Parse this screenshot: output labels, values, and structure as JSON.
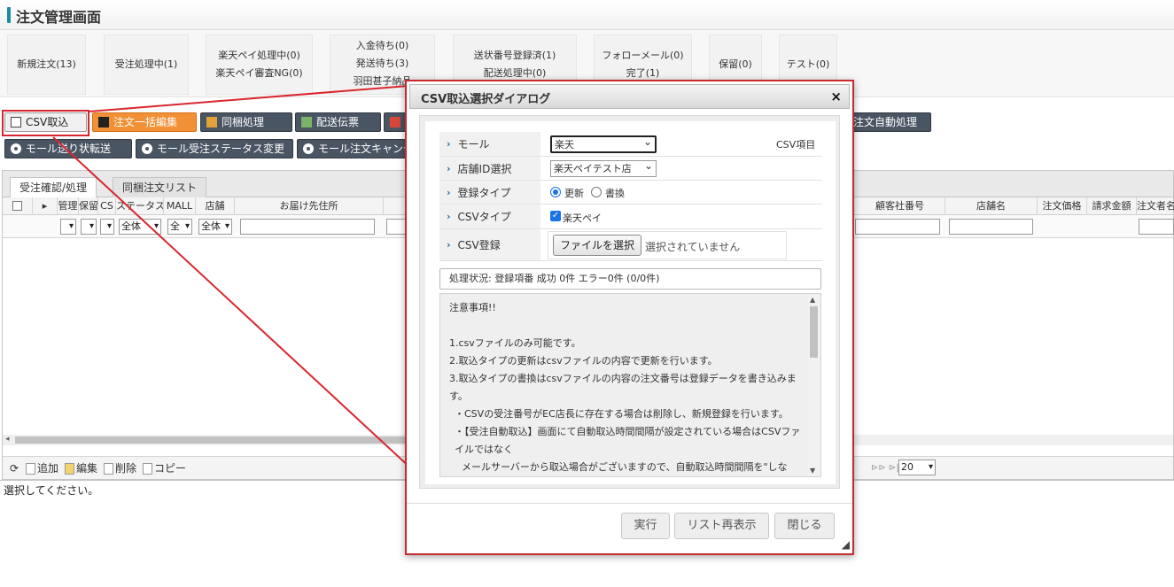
{
  "page": {
    "title": "注文管理画面"
  },
  "status_boxes": [
    {
      "lines": [
        "新規注文(13)"
      ]
    },
    {
      "lines": [
        "受注処理中(1)"
      ]
    },
    {
      "lines": [
        "楽天ペイ処理中(0)",
        "楽天ペイ審査NG(0)"
      ]
    },
    {
      "lines": [
        "入金待ち(0)",
        "発送待ち(3)",
        "羽田甚子納品"
      ]
    },
    {
      "lines": [
        "送状番号登録済(1)",
        "配送処理中(0)"
      ]
    },
    {
      "lines": [
        "フォローメール(0)",
        "完了(1)"
      ]
    },
    {
      "lines": [
        "保留(0)"
      ]
    },
    {
      "lines": [
        "テスト(0)"
      ]
    }
  ],
  "toolbar1": {
    "csv_import": "CSV取込",
    "bulk_edit": "注文一括編集",
    "bundle": "同梱処理",
    "shipping_slip": "配送伝票",
    "auto_process": "注文自動処理"
  },
  "toolbar2": {
    "mall_shipping": "モール送り状転送",
    "mall_status": "モール受注ステータス変更",
    "mall_cancel": "モール注文キャンセル"
  },
  "tabs": [
    "受注確認/処理",
    "同梱注文リスト"
  ],
  "grid": {
    "columns": [
      "管理",
      "保留",
      "CS",
      "ステータス",
      "MALL",
      "店舗",
      "お届け先住所",
      "顧客社番号",
      "店舗名",
      "注文価格",
      "請求金額",
      "注文者名"
    ],
    "filters": {
      "status": "全体",
      "mall": "全",
      "store": "全体"
    }
  },
  "footer": {
    "add": "追加",
    "edit": "編集",
    "delete": "削除",
    "copy": "コピー",
    "page_size": "20",
    "nav": "⊳⊳ ⊳|"
  },
  "select_message": "選択してください。",
  "dialog": {
    "title": "CSV取込選択ダイアログ",
    "close": "×",
    "fields": {
      "mall_label": "モール",
      "mall_value": "楽天",
      "csv_item_label": "CSV項目",
      "store_label": "店舗ID選択",
      "store_value": "楽天ペイテスト店",
      "register_type_label": "登録タイプ",
      "register_update": "更新",
      "register_overwrite": "書換",
      "csv_type_label": "CSVタイプ",
      "csv_type_value": "楽天ペイ",
      "csv_register_label": "CSV登録",
      "file_button": "ファイルを選択",
      "file_status": "選択されていません"
    },
    "status_line": "処理状況: 登録項番 成功 0件 エラー0件 (0/0件)",
    "notes": [
      "注意事項!!",
      "",
      "1.csvファイルのみ可能です。",
      "2.取込タイプの更新はcsvファイルの内容で更新を行います。",
      "3.取込タイプの書換はcsvファイルの内容の注文番号は登録データを書き込みます。",
      "・CSVの受注番号がEC店長に存在する場合は削除し、新規登録を行います。",
      "・【受注自動取込】画面にて自動取込時間間隔が設定されている場合はCSVファイルではなく",
      "メールサーバーから取込場合がございますので、自動取込時間間隔を\"しな"
    ],
    "buttons": {
      "run": "実行",
      "refresh": "リスト再表示",
      "close": "閉じる"
    }
  },
  "colors": {
    "accent": "#1e8aa3",
    "dark_button": "#4a5563",
    "orange": "#f29035",
    "highlight": "#d9262e"
  }
}
